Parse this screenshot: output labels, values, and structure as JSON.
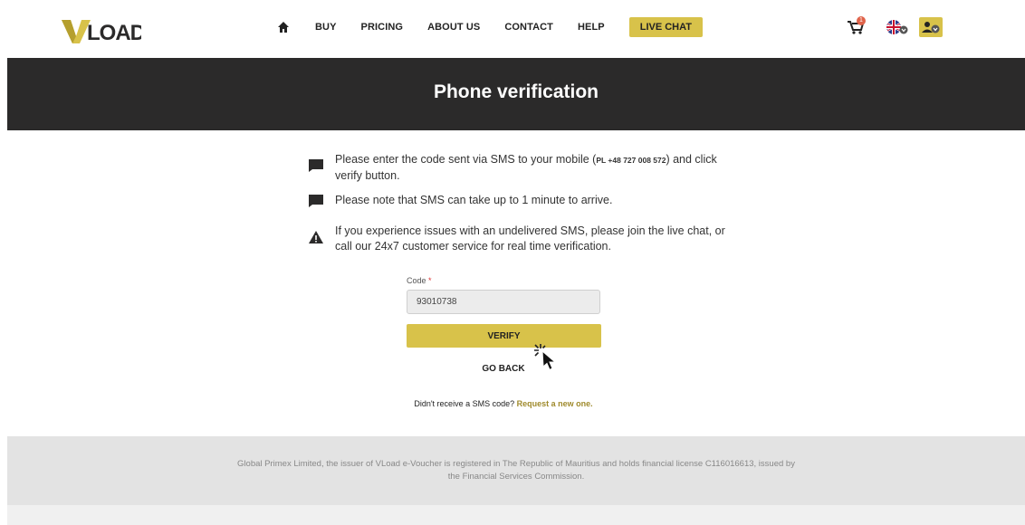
{
  "brand": {
    "logo_text": "LOAD"
  },
  "nav": {
    "items": [
      "BUY",
      "PRICING",
      "ABOUT US",
      "CONTACT",
      "HELP"
    ],
    "live_chat": "LIVE CHAT"
  },
  "cart": {
    "count": "1"
  },
  "page_title": "Phone verification",
  "notes": {
    "n1_before": "Please enter the code sent via SMS to your mobile (",
    "n1_phone": "PL +48 727 008 572",
    "n1_after": ") and click verify button.",
    "n2": "Please note that SMS can take up to 1 minute to arrive.",
    "n3": "If you experience issues with an undelivered SMS, please join the live chat, or call our 24x7 customer service for real time verification."
  },
  "form": {
    "code_label": "Code",
    "required_mark": "*",
    "code_value": "93010738",
    "verify_label": "VERIFY",
    "go_back_label": "GO BACK",
    "resend_prompt": "Didn't receive a SMS code?",
    "resend_link": "Request a new one."
  },
  "footer": {
    "line": "Global Primex Limited, the issuer of VLoad e-Voucher is registered in The Republic of Mauritius and holds financial license C116016613, issued by the Financial Services Commission."
  },
  "colors": {
    "accent": "#d8c24a",
    "hero_bg": "#2b2a2a",
    "link": "#9f8a2c",
    "badge": "#e0634a"
  },
  "icons": [
    "home-icon",
    "cart-icon",
    "uk-flag-icon",
    "user-icon",
    "speech-bubble-icon",
    "warning-icon",
    "cursor-icon"
  ]
}
